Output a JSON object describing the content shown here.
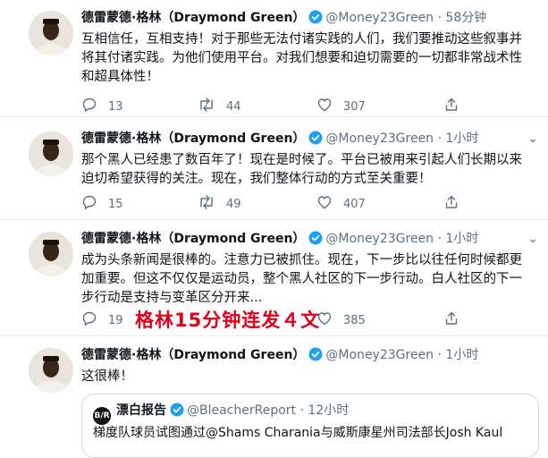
{
  "tweets": [
    {
      "name": "德雷蒙德·格林（Draymond Green）",
      "handle": "@Money23Green",
      "time": "58分钟",
      "text": "互相信任，互相支持！对于那些无法付诸实践的人们，我们要推动这些叙事并将其付诸实践。为他们使用平台。对我们想要和迫切需要的一切都非常战术性和超具体性！",
      "replies": "13",
      "retweets": "44",
      "likes": "307"
    },
    {
      "name": "德雷蒙德·格林（Draymond Green）",
      "handle": "@Money23Green",
      "time": "1小时",
      "text": "那个黑人已经患了数百年了！现在是时候了。平台已被用来引起人们长期以来迫切希望获得的关注。现在，我们整体行动的方式至关重要！",
      "replies": "15",
      "retweets": "49",
      "likes": "407"
    },
    {
      "name": "德雷蒙德·格林（Draymond Green）",
      "handle": "@Money23Green",
      "time": "1小时",
      "text": "成为头条新闻是很棒的。注意力已被抓住。现在，下一步比以往任何时候都更加重要。但这不仅仅是运动员，整个黑人社区的下一步行动。白人社区的下一步行动是支持与变革区分开来...",
      "replies": "19",
      "retweets": "",
      "likes": "385"
    },
    {
      "name": "德雷蒙德·格林（Draymond Green）",
      "handle": "@Money23Green",
      "time": "1小时",
      "text": "这很棒！"
    }
  ],
  "overlay_caption": "格林15分钟连发４文",
  "quote": {
    "logo": "B/R",
    "name": "漂白报告",
    "handle": "@BleacherReport",
    "time": "12小时",
    "text": "梯度队球员试图通过@Shams Charania与威斯康星州司法部长Josh Kaul"
  },
  "colors": {
    "verified": "#1da1f2",
    "caption": "#e0001b",
    "icon": "#5b7083"
  }
}
